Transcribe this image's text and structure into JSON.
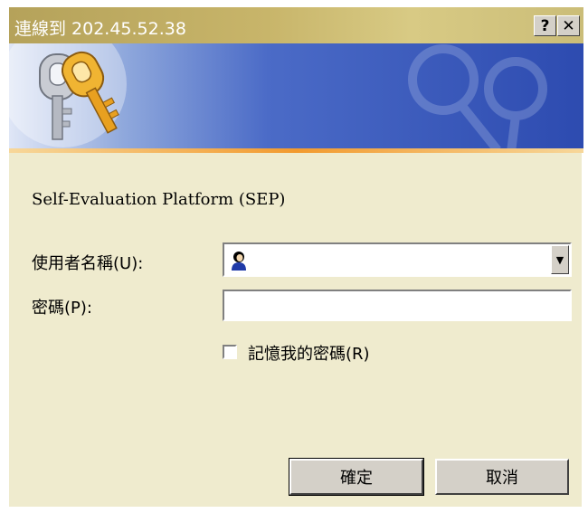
{
  "dialog": {
    "title": "連線到 202.45.52.38",
    "help_button": "?",
    "close_button": "✕",
    "site_label": "Self-Evaluation Platform (SEP)",
    "username_label": "使用者名稱(U):",
    "username_value": "",
    "password_label": "密碼(P):",
    "password_value": "",
    "remember_label": "記憶我的密碼(R)",
    "remember_checked": false,
    "ok_button": "確定",
    "cancel_button": "取消"
  },
  "colors": {
    "dialog_bg": "#efebce",
    "titlebar": "#c8b56a",
    "banner_blue": "#2d4bb0",
    "accent_orange": "#f29a2e"
  }
}
